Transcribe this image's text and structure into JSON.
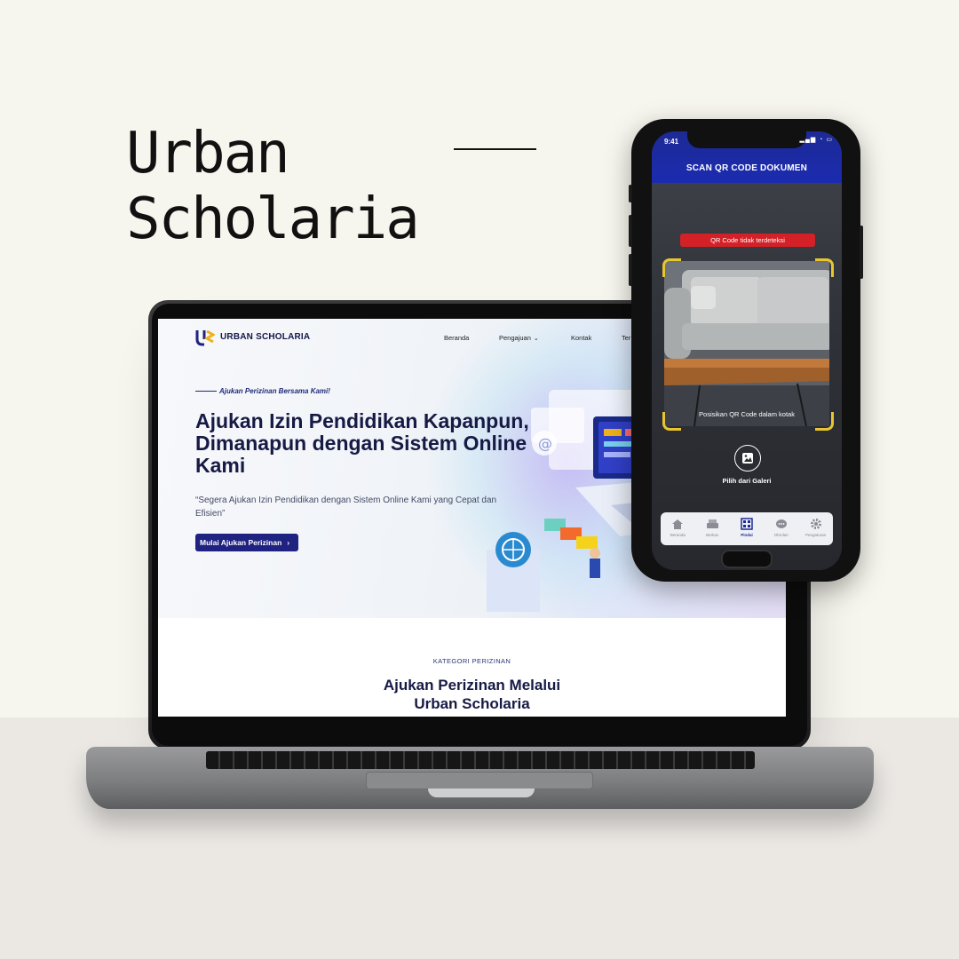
{
  "title": {
    "line1": "Urban",
    "line2": "Scholaria"
  },
  "website": {
    "brand": "URBAN SCHOLARIA",
    "nav": [
      "Beranda",
      "Pengajuan",
      "Kontak",
      "Ter"
    ],
    "kicker": "Ajukan Perizinan Bersama Kami!",
    "headline": "Ajukan Izin Pendidikan Kapanpun, Dimanapun dengan Sistem Online Kami",
    "subtext": "“Segera Ajukan Izin Pendidikan dengan Sistem Online Kami yang Cepat dan Efisien”",
    "cta_label": "Mulai Ajukan Perizinan",
    "section_kicker": "KATEGORI PERIZINAN",
    "section_title_line1": "Ajukan Perizinan Melalui",
    "section_title_line2": "Urban Scholaria"
  },
  "phone": {
    "time": "9:41",
    "header_title": "SCAN QR CODE DOKUMEN",
    "alert": "QR Code tidak terdeteksi",
    "hint": "Posisikan QR Code dalam kotak",
    "gallery_label": "Pilih dari Galeri",
    "tabs": [
      {
        "label": "Beranda",
        "icon": "home-icon"
      },
      {
        "label": "Berkas",
        "icon": "inbox-icon"
      },
      {
        "label": "Pindai",
        "icon": "qr-scan-icon",
        "active": true
      },
      {
        "label": "Obrolan",
        "icon": "chat-icon"
      },
      {
        "label": "Pengaturan",
        "icon": "gear-icon"
      }
    ]
  },
  "colors": {
    "brand_navy": "#1f2280",
    "phone_header": "#1b2bb0",
    "alert_red": "#d42027",
    "scan_frame": "#e8c630"
  }
}
